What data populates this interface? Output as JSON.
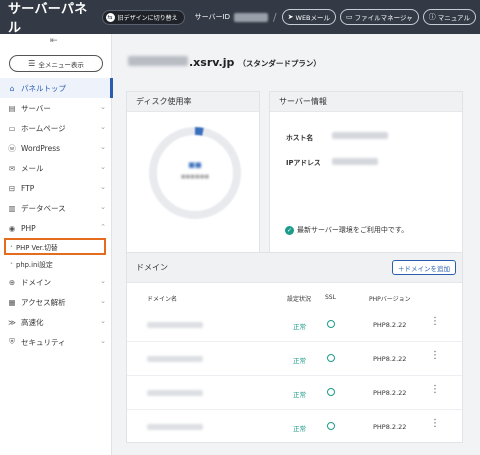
{
  "header": {
    "brand": "サーバーパネル",
    "old_design": "旧デザインに切り替え",
    "server_id_label": "サーバーID",
    "sep": "/",
    "links": [
      {
        "label": "WEBメール",
        "icon": "send-icon"
      },
      {
        "label": "ファイルマネージャ",
        "icon": "folder-icon"
      },
      {
        "label": "マニュアル",
        "icon": "help-icon"
      }
    ]
  },
  "sidebar": {
    "collapse": "⇤",
    "all_menu": "全メニュー表示",
    "items": [
      {
        "label": "パネルトップ",
        "icon": "⌂",
        "active": true
      },
      {
        "label": "サーバー",
        "icon": "▤",
        "chevron": "⌄"
      },
      {
        "label": "ホームページ",
        "icon": "▭",
        "chevron": "⌄"
      },
      {
        "label": "WordPress",
        "icon": "ⓦ",
        "chevron": "⌄"
      },
      {
        "label": "メール",
        "icon": "✉",
        "chevron": "⌄"
      },
      {
        "label": "FTP",
        "icon": "⊟",
        "chevron": "⌄"
      },
      {
        "label": "データベース",
        "icon": "▥",
        "chevron": "⌄"
      },
      {
        "label": "PHP",
        "icon": "◉",
        "chevron": "⌃"
      }
    ],
    "php_sub": [
      {
        "label": "PHP Ver.切替"
      },
      {
        "label": "php.ini設定"
      }
    ],
    "items_after": [
      {
        "label": "ドメイン",
        "icon": "⊕",
        "chevron": "⌄"
      },
      {
        "label": "アクセス解析",
        "icon": "▦",
        "chevron": "⌄"
      },
      {
        "label": "高速化",
        "icon": "≫",
        "chevron": "⌄"
      },
      {
        "label": "セキュリティ",
        "icon": "⛨",
        "chevron": "⌄"
      }
    ]
  },
  "main": {
    "domain_suffix": ".xsrv.jp",
    "plan": "（スタンダードプラン）",
    "disk": {
      "title": "ディスク使用率"
    },
    "server_info": {
      "title": "サーバー情報",
      "host_label": "ホスト名",
      "ip_label": "IPアドレス",
      "env_text": "最新サーバー環境をご利用中です。"
    },
    "domains": {
      "title": "ドメイン",
      "add_label": "＋ドメインを追加",
      "col_domain": "ドメイン名",
      "col_status": "設定状況",
      "col_ssl": "SSL",
      "col_php": "PHPバージョン",
      "rows": [
        {
          "status": "正常",
          "php": "PHP8.2.22"
        },
        {
          "status": "正常",
          "php": "PHP8.2.22"
        },
        {
          "status": "正常",
          "php": "PHP8.2.22"
        },
        {
          "status": "正常",
          "php": "PHP8.2.22"
        }
      ]
    }
  },
  "colors": {
    "accent": "#2a5db0",
    "header_bg": "#333a45",
    "ok": "#1c9c8a",
    "highlight": "#e56c1e"
  }
}
